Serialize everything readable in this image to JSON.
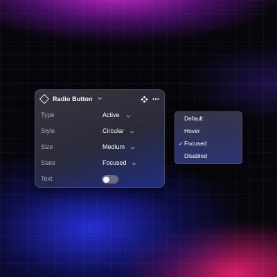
{
  "panel": {
    "title": "Radio Button",
    "rows": [
      {
        "label": "Type",
        "value": "Active"
      },
      {
        "label": "Style",
        "value": "Circular"
      },
      {
        "label": "Size",
        "value": "Medium"
      },
      {
        "label": "State",
        "value": "Focused"
      },
      {
        "label": "Text",
        "toggle_on": false
      }
    ]
  },
  "dropdown": {
    "items": [
      {
        "label": "Default"
      },
      {
        "label": "Hover"
      },
      {
        "label": "Focused",
        "selected": true,
        "check": "✓"
      },
      {
        "label": "Disabled"
      }
    ]
  },
  "icons": {
    "component": "component-diamond-icon",
    "move": "move-arrows-icon",
    "more": "more-horizontal-icon",
    "chevron": "chevron-down-icon",
    "check": "check-icon"
  },
  "colors": {
    "panel_bg": "#3a3842",
    "label_text": "#a9a8b4",
    "value_text": "#ffffff",
    "toggle_off": "#6b6c84",
    "accent_blue": "#2230a0",
    "accent_magenta": "#c828d2",
    "accent_pink": "#e61e6e"
  }
}
